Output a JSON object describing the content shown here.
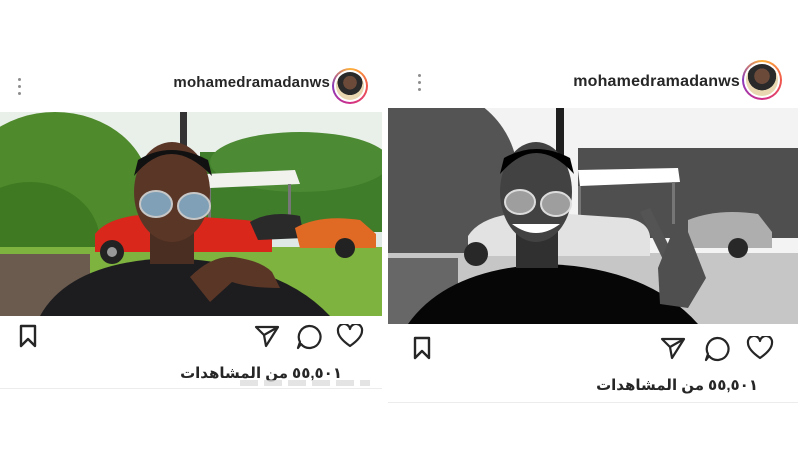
{
  "posts": [
    {
      "username": "mohamedramadanws",
      "views_count": "٥٥,٥٠١",
      "views_label": "من المشاهدات",
      "filter": "color",
      "icons": {
        "more": "more-vertical-icon",
        "save": "bookmark-icon",
        "share": "send-icon",
        "comment": "comment-icon",
        "like": "heart-icon"
      }
    },
    {
      "username": "mohamedramadanws",
      "views_count": "٥٥,٥٠١",
      "views_label": "من المشاهدات",
      "filter": "grayscale",
      "icons": {
        "more": "more-vertical-icon",
        "save": "bookmark-icon",
        "share": "send-icon",
        "comment": "comment-icon",
        "like": "heart-icon"
      }
    }
  ],
  "colors": {
    "text": "#262626",
    "icon": "#262626",
    "muted": "#8e8e8e",
    "avatar_ring": [
      "#fdb23a",
      "#f1584a",
      "#d12e89",
      "#8a3ab9"
    ]
  }
}
